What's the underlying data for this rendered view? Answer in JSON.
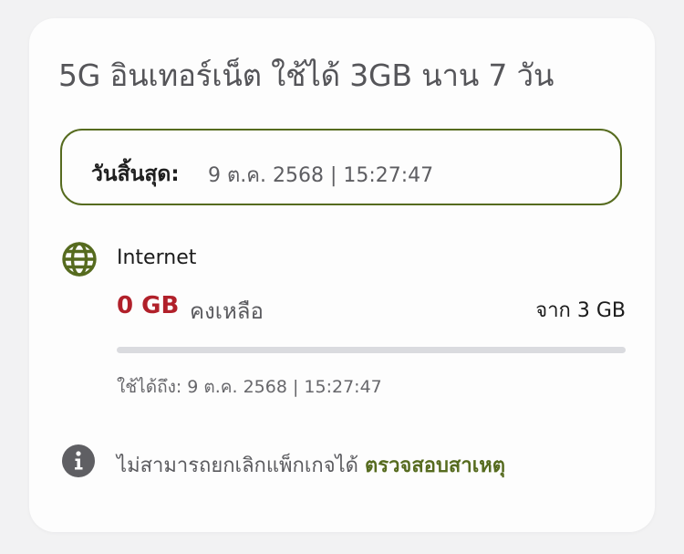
{
  "package": {
    "title": "5G อินเทอร์เน็ต ใช้ได้ 3GB นาน 7 วัน"
  },
  "expiry": {
    "label": "วันสิ้นสุด:",
    "value": "9 ต.ค. 2568 | 15:27:47"
  },
  "usage": {
    "service_icon": "globe-icon",
    "service_name": "Internet",
    "remaining_value": "0 GB",
    "remaining_label": "คงเหลือ",
    "total": "จาก 3 GB",
    "remaining_fraction": 0,
    "used_until": "ใช้ได้ถึง: 9 ต.ค. 2568 | 15:27:47"
  },
  "notice": {
    "icon": "info-icon",
    "text": "ไม่สามารถยกเลิกแพ็กเกจได้",
    "link_label": "ตรวจสอบสาเหตุ"
  },
  "colors": {
    "accent": "#566b1f",
    "remaining": "#b1202a",
    "track": "#dadbdf"
  }
}
